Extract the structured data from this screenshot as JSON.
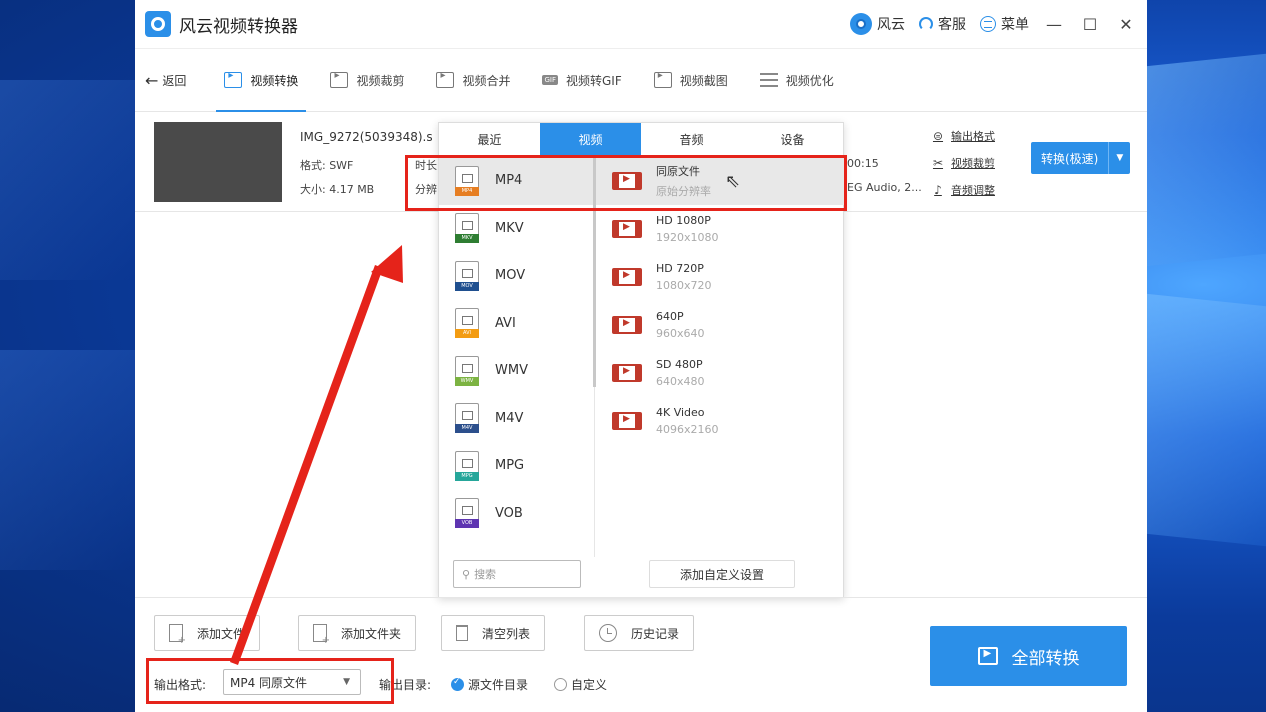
{
  "app": {
    "title": "风云视频转换器",
    "brand": "风云",
    "service": "客服",
    "menu": "菜单"
  },
  "window_controls": {
    "minimize": "—",
    "maximize": "☐",
    "close": "✕"
  },
  "nav": {
    "back": "返回",
    "tabs": [
      {
        "label": "视频转换",
        "active": true
      },
      {
        "label": "视频裁剪"
      },
      {
        "label": "视频合并"
      },
      {
        "label": "视频转GIF"
      },
      {
        "label": "视频截图"
      },
      {
        "label": "视频优化"
      }
    ]
  },
  "file": {
    "name": "IMG_9272(5039348).s",
    "format_label": "格式: SWF",
    "size_label": "大小: 4.17 MB",
    "duration_prefix": "时长",
    "resolution_prefix": "分辨",
    "duration_tail": "00:15",
    "audio_tail": "EG Audio, 2...",
    "links": {
      "output_format": "输出格式",
      "video_crop": "视频裁剪",
      "audio_adjust": "音频调整"
    },
    "convert_button": "转换(极速)"
  },
  "dropdown": {
    "tabs": [
      "最近",
      "视频",
      "音频",
      "设备"
    ],
    "active_tab": "视频",
    "formats": [
      {
        "name": "MP4",
        "tag": "MP4",
        "color": "#e67e22",
        "selected": true
      },
      {
        "name": "MKV",
        "tag": "MKV",
        "color": "#2e7d32"
      },
      {
        "name": "MOV",
        "tag": "MOV",
        "color": "#1f4f8f"
      },
      {
        "name": "AVI",
        "tag": "AVI",
        "color": "#f39c12"
      },
      {
        "name": "WMV",
        "tag": "WMV",
        "color": "#7cb342"
      },
      {
        "name": "M4V",
        "tag": "M4V",
        "color": "#2c4f8c"
      },
      {
        "name": "MPG",
        "tag": "MPG",
        "color": "#26a69a"
      },
      {
        "name": "VOB",
        "tag": "VOB",
        "color": "#5e35b1"
      }
    ],
    "resolutions": [
      {
        "name": "同原文件",
        "size": "原始分辨率",
        "selected": true
      },
      {
        "name": "HD 1080P",
        "size": "1920x1080"
      },
      {
        "name": "HD 720P",
        "size": "1080x720"
      },
      {
        "name": "640P",
        "size": "960x640"
      },
      {
        "name": "SD 480P",
        "size": "640x480"
      },
      {
        "name": "4K Video",
        "size": "4096x2160"
      }
    ],
    "search_placeholder": "搜索",
    "custom_button": "添加自定义设置"
  },
  "bottom": {
    "add_file": "添加文件",
    "add_folder": "添加文件夹",
    "clear_list": "清空列表",
    "history": "历史记录",
    "output_format_label": "输出格式:",
    "output_format_value": "MP4 同原文件",
    "output_dir_label": "输出目录:",
    "dir_source": "源文件目录",
    "dir_custom": "自定义",
    "convert_all": "全部转换"
  },
  "colors": {
    "accent": "#2b8fe8",
    "highlight": "#e5231a"
  }
}
